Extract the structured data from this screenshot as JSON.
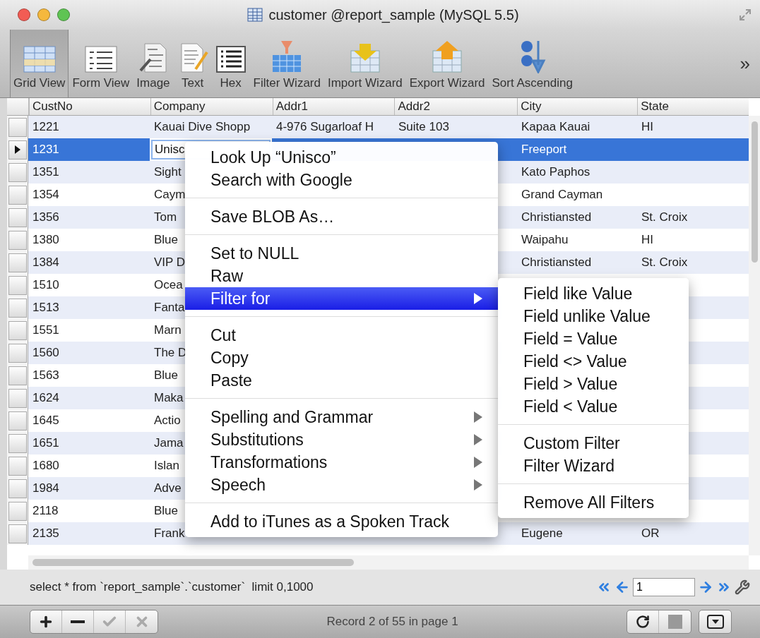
{
  "window": {
    "title": "customer @report_sample (MySQL 5.5)"
  },
  "toolbar": {
    "buttons": [
      {
        "label": "Grid View",
        "selected": true
      },
      {
        "label": "Form View",
        "selected": false
      },
      {
        "label": "Image",
        "selected": false
      },
      {
        "label": "Text",
        "selected": false
      },
      {
        "label": "Hex",
        "selected": false
      },
      {
        "label": "Filter Wizard",
        "selected": false
      },
      {
        "label": "Import Wizard",
        "selected": false
      },
      {
        "label": "Export Wizard",
        "selected": false
      },
      {
        "label": "Sort Ascending",
        "selected": false
      }
    ],
    "overflow": "»"
  },
  "table": {
    "columns": [
      "CustNo",
      "Company",
      "Addr1",
      "Addr2",
      "City",
      "State"
    ],
    "rows": [
      {
        "selected": false,
        "cells": [
          "1221",
          "Kauai Dive Shopp",
          "4-976 Sugarloaf H",
          "Suite 103",
          "Kapaa Kauai",
          "HI"
        ]
      },
      {
        "selected": true,
        "cells": [
          "1231",
          "Unisc",
          "",
          "",
          "Freeport",
          ""
        ]
      },
      {
        "selected": false,
        "cells": [
          "1351",
          "Sight",
          "",
          "",
          "Kato Paphos",
          ""
        ]
      },
      {
        "selected": false,
        "cells": [
          "1354",
          "Caym",
          "",
          "",
          "Grand Cayman",
          ""
        ]
      },
      {
        "selected": false,
        "cells": [
          "1356",
          "Tom",
          "",
          "",
          "Christiansted",
          "St. Croix"
        ]
      },
      {
        "selected": false,
        "cells": [
          "1380",
          "Blue",
          "",
          "",
          "Waipahu",
          "HI"
        ]
      },
      {
        "selected": false,
        "cells": [
          "1384",
          "VIP D",
          "",
          "",
          "Christiansted",
          "St. Croix"
        ]
      },
      {
        "selected": false,
        "cells": [
          "1510",
          "Ocea",
          "",
          "",
          "",
          ""
        ]
      },
      {
        "selected": false,
        "cells": [
          "1513",
          "Fanta",
          "",
          "",
          "",
          ""
        ]
      },
      {
        "selected": false,
        "cells": [
          "1551",
          "Marn",
          "",
          "",
          "",
          ""
        ]
      },
      {
        "selected": false,
        "cells": [
          "1560",
          "The D",
          "",
          "",
          "",
          ""
        ]
      },
      {
        "selected": false,
        "cells": [
          "1563",
          "Blue",
          "",
          "",
          "",
          ""
        ]
      },
      {
        "selected": false,
        "cells": [
          "1624",
          "Maka",
          "",
          "",
          "",
          ""
        ]
      },
      {
        "selected": false,
        "cells": [
          "1645",
          "Actio",
          "",
          "",
          "",
          ""
        ]
      },
      {
        "selected": false,
        "cells": [
          "1651",
          "Jama",
          "",
          "",
          "",
          ""
        ]
      },
      {
        "selected": false,
        "cells": [
          "1680",
          "Islan",
          "",
          "",
          "",
          ""
        ]
      },
      {
        "selected": false,
        "cells": [
          "1984",
          "Adve",
          "",
          "",
          "",
          ""
        ]
      },
      {
        "selected": false,
        "cells": [
          "2118",
          "Blue",
          "",
          "",
          "",
          ""
        ]
      },
      {
        "selected": false,
        "cells": [
          "2135",
          "Frank",
          "",
          "",
          "Eugene",
          "OR"
        ]
      }
    ]
  },
  "context_menu": {
    "groups": [
      [
        {
          "label": "Look Up “Unisco”",
          "submenu": false,
          "selected": false
        },
        {
          "label": "Search with Google",
          "submenu": false,
          "selected": false
        }
      ],
      [
        {
          "label": "Save BLOB As…",
          "submenu": false,
          "selected": false
        }
      ],
      [
        {
          "label": "Set to NULL",
          "submenu": false,
          "selected": false
        },
        {
          "label": "Raw",
          "submenu": false,
          "selected": false
        },
        {
          "label": "Filter for",
          "submenu": true,
          "selected": true
        }
      ],
      [
        {
          "label": "Cut",
          "submenu": false,
          "selected": false
        },
        {
          "label": "Copy",
          "submenu": false,
          "selected": false
        },
        {
          "label": "Paste",
          "submenu": false,
          "selected": false
        }
      ],
      [
        {
          "label": "Spelling and Grammar",
          "submenu": true,
          "selected": false
        },
        {
          "label": "Substitutions",
          "submenu": true,
          "selected": false
        },
        {
          "label": "Transformations",
          "submenu": true,
          "selected": false
        },
        {
          "label": "Speech",
          "submenu": true,
          "selected": false
        }
      ],
      [
        {
          "label": "Add to iTunes as a Spoken Track",
          "submenu": false,
          "selected": false
        }
      ]
    ]
  },
  "submenu": {
    "groups": [
      [
        "Field like Value",
        "Field unlike Value",
        "Field = Value",
        "Field <> Value",
        "Field > Value",
        "Field < Value"
      ],
      [
        "Custom Filter",
        "Filter Wizard"
      ],
      [
        "Remove All Filters"
      ]
    ]
  },
  "status": {
    "query": "select * from `report_sample`.`customer`  limit 0,1000",
    "page": "1"
  },
  "bottom_bar": {
    "edit_buttons": [
      {
        "disabled": false
      },
      {
        "disabled": false
      },
      {
        "disabled": true
      },
      {
        "disabled": true
      }
    ],
    "record": "Record 2 of 55 in page 1"
  }
}
